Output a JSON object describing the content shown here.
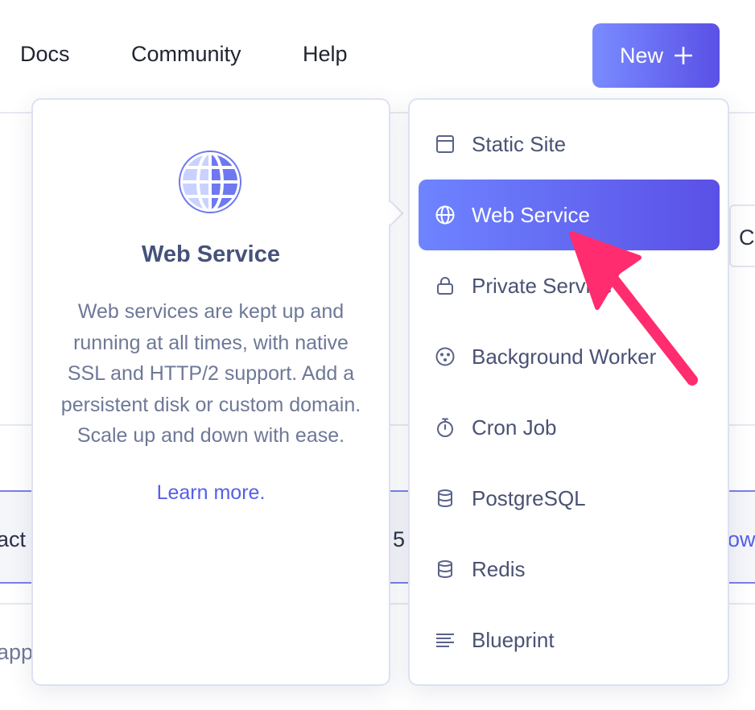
{
  "nav": {
    "links": [
      "Docs",
      "Community",
      "Help"
    ],
    "new_button": {
      "label": "New",
      "icon": "plus-icon"
    }
  },
  "background": {
    "right_edge_char": "C",
    "row_left_fragment": "act",
    "row_number": "5",
    "row_right_fragment": "ow",
    "bottom_left_fragment": "app"
  },
  "info_panel": {
    "icon": "globe-icon",
    "title": "Web Service",
    "description": "Web services are kept up and running at all times, with native SSL and HTTP/2 support. Add a persistent disk or custom domain. Scale up and down with ease.",
    "learn_more": "Learn more."
  },
  "menu": {
    "items": [
      {
        "label": "Static Site",
        "icon": "browser-window-icon",
        "active": false
      },
      {
        "label": "Web Service",
        "icon": "globe-icon",
        "active": true
      },
      {
        "label": "Private Service",
        "icon": "lock-icon",
        "active": false
      },
      {
        "label": "Background Worker",
        "icon": "cog-dots-icon",
        "active": false
      },
      {
        "label": "Cron Job",
        "icon": "stopwatch-icon",
        "active": false
      },
      {
        "label": "PostgreSQL",
        "icon": "database-icon",
        "active": false
      },
      {
        "label": "Redis",
        "icon": "database-icon",
        "active": false
      },
      {
        "label": "Blueprint",
        "icon": "lines-icon",
        "active": false
      }
    ]
  },
  "colors": {
    "accent_start": "#6e84ff",
    "accent_end": "#5a50e6",
    "annotation_arrow": "#ff2d6f",
    "link": "#5560e8"
  }
}
